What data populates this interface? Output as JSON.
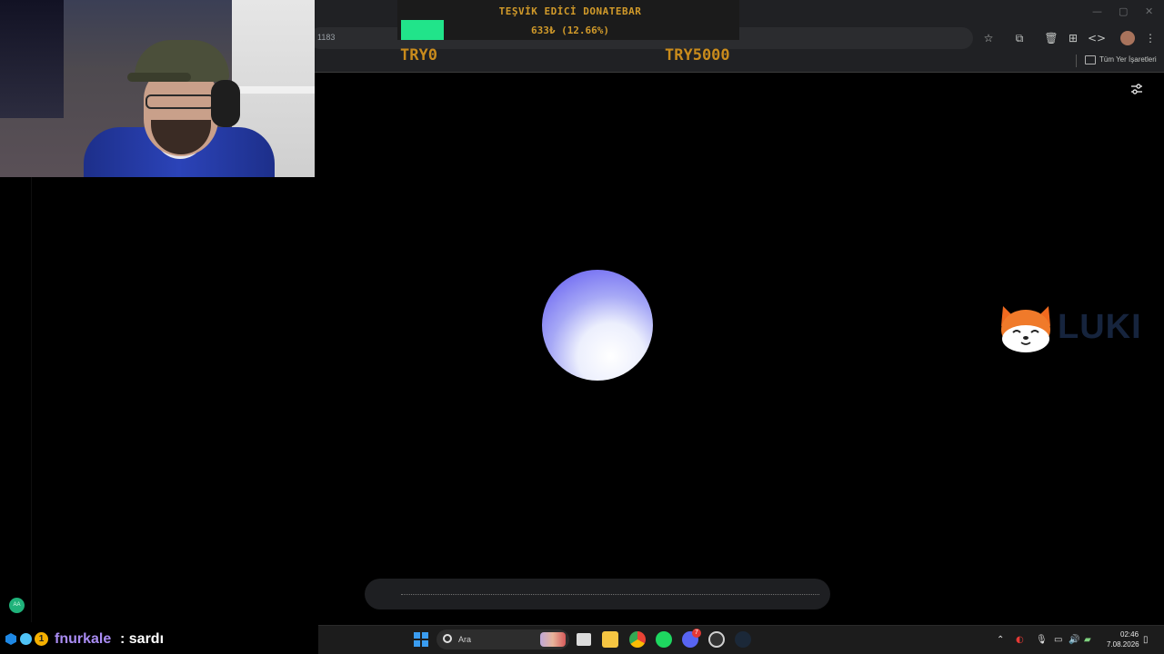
{
  "browser": {
    "url_fragment": "1183",
    "bookmarks_label": "Tüm Yer İşaretleri"
  },
  "donatebar": {
    "title": "TEŞVİK EDİCİ DONATEBAR",
    "amount_text": "633₺ (12.66%)",
    "progress": 0.1266,
    "min_label": "TRY0",
    "max_label": "TRY5000",
    "fill_color": "#21e48a",
    "text_color": "#d19a2a"
  },
  "brand": {
    "name": "LUKI"
  },
  "badge": {
    "initials": "AA"
  },
  "chat": {
    "badge_number": "1",
    "username": "fnurkale",
    "separator": ":",
    "message": "sardı"
  },
  "taskbar": {
    "search_placeholder": "Ara",
    "discord_badge": "7",
    "time": "02:46",
    "date": "7.08.2026"
  },
  "icons": {
    "window_controls": [
      "minimize-icon",
      "maximize-icon",
      "close-icon"
    ],
    "toolbar": [
      "star-icon",
      "extensions-icon",
      "trash-icon",
      "grid-icon",
      "code-icon",
      "profile-avatar",
      "menu-icon"
    ]
  }
}
